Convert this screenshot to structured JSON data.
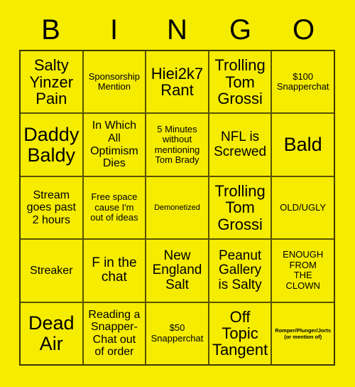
{
  "card": {
    "title_letters": [
      "B",
      "I",
      "N",
      "G",
      "O"
    ],
    "background_color": "#f5ec00",
    "text_color": "#000000",
    "border_color": "#3d3800",
    "grid_size": "5x5"
  },
  "cells": [
    {
      "text": "Salty\nYinzer\nPain",
      "size": "fs-xl",
      "name": "bingo-cell-b1"
    },
    {
      "text": "Sponsorship\nMention",
      "size": "fs-sm",
      "name": "bingo-cell-i1"
    },
    {
      "text": "Hiei2k7\nRant",
      "size": "fs-xl",
      "name": "bingo-cell-n1"
    },
    {
      "text": "Trolling\nTom\nGrossi",
      "size": "fs-xl",
      "name": "bingo-cell-g1"
    },
    {
      "text": "$100\nSnapperchat",
      "size": "fs-sm",
      "name": "bingo-cell-o1"
    },
    {
      "text": "Daddy\nBaldy",
      "size": "fs-xxl",
      "name": "bingo-cell-b2"
    },
    {
      "text": "In Which\nAll\nOptimism\nDies",
      "size": "fs-md",
      "name": "bingo-cell-i2"
    },
    {
      "text": "5 Minutes\nwithout\nmentioning\nTom Brady",
      "size": "fs-sm",
      "name": "bingo-cell-n2"
    },
    {
      "text": "NFL is\nScrewed",
      "size": "fs-lg",
      "name": "bingo-cell-g2"
    },
    {
      "text": "Bald",
      "size": "fs-xxl",
      "name": "bingo-cell-o2"
    },
    {
      "text": "Stream\ngoes past\n2 hours",
      "size": "fs-md",
      "name": "bingo-cell-b3"
    },
    {
      "text": "Free space\ncause I'm\nout of ideas",
      "size": "fs-sm",
      "name": "bingo-cell-i3"
    },
    {
      "text": "Demonetized",
      "size": "fs-xs",
      "name": "bingo-cell-n3"
    },
    {
      "text": "Trolling\nTom\nGrossi",
      "size": "fs-xl",
      "name": "bingo-cell-g3"
    },
    {
      "text": "OLD/UGLY",
      "size": "fs-sm",
      "name": "bingo-cell-o3"
    },
    {
      "text": "Streaker",
      "size": "fs-md",
      "name": "bingo-cell-b4"
    },
    {
      "text": "F in the\nchat",
      "size": "fs-lg",
      "name": "bingo-cell-i4"
    },
    {
      "text": "New\nEngland\nSalt",
      "size": "fs-lg",
      "name": "bingo-cell-n4"
    },
    {
      "text": "Peanut\nGallery\nis Salty",
      "size": "fs-lg",
      "name": "bingo-cell-g4"
    },
    {
      "text": "ENOUGH\nFROM\nTHE\nCLOWN",
      "size": "fs-sm",
      "name": "bingo-cell-o4"
    },
    {
      "text": "Dead\nAir",
      "size": "fs-xxl",
      "name": "bingo-cell-b5"
    },
    {
      "text": "Reading a\nSnapper-\nChat out\nof order",
      "size": "fs-md",
      "name": "bingo-cell-i5"
    },
    {
      "text": "$50\nSnapperchat",
      "size": "fs-sm",
      "name": "bingo-cell-n5"
    },
    {
      "text": "Off\nTopic\nTangent",
      "size": "fs-xl",
      "name": "bingo-cell-g5"
    },
    {
      "text": "Romper/Plunger/Jorts\n(or mention of)",
      "size": "fs-xxs",
      "name": "bingo-cell-o5"
    }
  ]
}
